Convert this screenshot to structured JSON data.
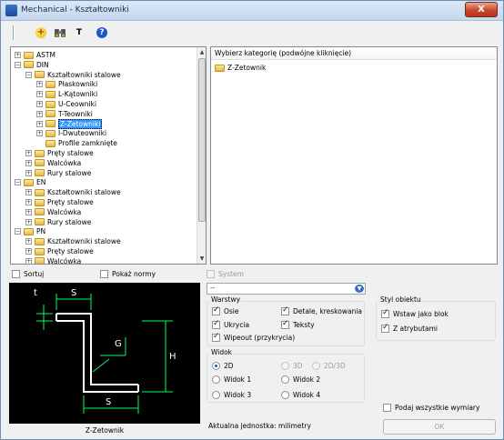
{
  "window": {
    "title": "Mechanical - Kształtowniki",
    "close_label": "X"
  },
  "toolbar": {
    "text_tool_label": "T"
  },
  "tree": {
    "rows": [
      {
        "label": "ASTM",
        "toggle": "+"
      },
      {
        "label": "DIN",
        "toggle": "−"
      },
      {
        "label": "Kształtowniki stalowe",
        "toggle": "−"
      },
      {
        "label": "Płaskowniki",
        "toggle": "+"
      },
      {
        "label": "L-Kątowniki",
        "toggle": "+"
      },
      {
        "label": "U-Ceowniki",
        "toggle": "+"
      },
      {
        "label": "T-Teowniki",
        "toggle": "+"
      },
      {
        "label": "Z-Zetowniki",
        "toggle": "+",
        "selected": true
      },
      {
        "label": "I-Dwuteowniki",
        "toggle": "+"
      },
      {
        "label": "Profile zamknięte",
        "toggle": ""
      },
      {
        "label": "Pręty stalowe",
        "toggle": "+"
      },
      {
        "label": "Walcówka",
        "toggle": "+"
      },
      {
        "label": "Rury stalowe",
        "toggle": "+"
      },
      {
        "label": "EN",
        "toggle": "−"
      },
      {
        "label": "Kształtowniki stalowe",
        "toggle": "+"
      },
      {
        "label": "Pręty stalowe",
        "toggle": "+"
      },
      {
        "label": "Walcówka",
        "toggle": "+"
      },
      {
        "label": "Rury stalowe",
        "toggle": "+"
      },
      {
        "label": "PN",
        "toggle": "−"
      },
      {
        "label": "Kształtowniki stalowe",
        "toggle": "+"
      },
      {
        "label": "Pręty stalowe",
        "toggle": "+"
      },
      {
        "label": "Walcówka",
        "toggle": "+"
      },
      {
        "label": "Rury stalowe",
        "toggle": "+"
      }
    ]
  },
  "list": {
    "header": "Wybierz kategorię (podwójne kliknięcie)",
    "items": [
      "Z-Zetownik"
    ]
  },
  "options": {
    "sort_label": "Sortuj",
    "sort_checked": false,
    "show_norms_label": "Pokaż normy",
    "show_norms_checked": false,
    "system_label": "System",
    "system_checked": false
  },
  "combo": {
    "value": "--"
  },
  "layers": {
    "title": "Warstwy",
    "axes": "Osie",
    "hidden": "Ukrycia",
    "wipeout": "Wipeout (przykrycia)",
    "details": "Detale, kreskowania",
    "texts": "Teksty"
  },
  "view": {
    "title": "Widok",
    "v2d": "2D",
    "v3d": "3D",
    "v2d3d": "2D/3D",
    "view1": "Widok 1",
    "view2": "Widok 2",
    "view3": "Widok 3",
    "view4": "Widok 4",
    "selected": "2D"
  },
  "object_style": {
    "title": "Styl obiektu",
    "as_block": "Wstaw jako blok",
    "with_attributes": "Z atrybutami"
  },
  "all_dims_label": "Podaj wszystkie wymiary",
  "preview": {
    "caption": "Z-Zetownik",
    "labels": {
      "s_top": "S",
      "t": "t",
      "g": "G",
      "h": "H",
      "s_bottom": "S"
    }
  },
  "status": "Aktualna jednostka: milimetry",
  "ok_label": "OK"
}
